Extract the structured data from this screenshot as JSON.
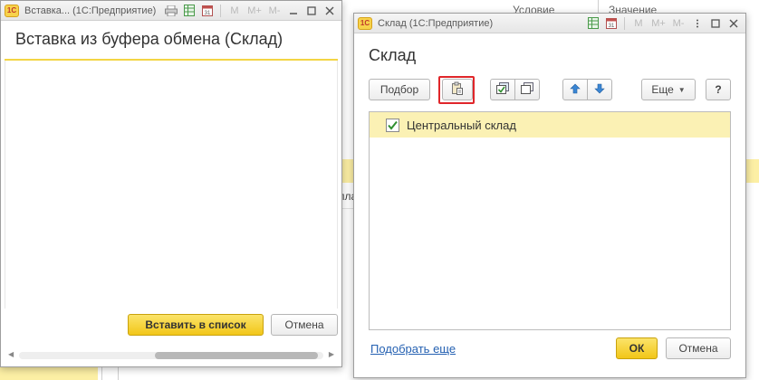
{
  "background": {
    "column_condition": "Условие",
    "column_value": "Значение",
    "fragment": "пла"
  },
  "left_window": {
    "app_logo": "1С",
    "window_title": "Вставка... (1С:Предприятие)",
    "toolbar_letters": [
      "M",
      "M+",
      "M-"
    ],
    "form_title": "Вставка из буфера обмена (Склад)",
    "insert_button": "Вставить в список",
    "cancel_button": "Отмена"
  },
  "right_window": {
    "app_logo": "1С",
    "window_title": "Склад (1С:Предприятие)",
    "toolbar_letters": [
      "M",
      "M+",
      "M-"
    ],
    "form_title": "Склад",
    "toolbar": {
      "pick_button": "Подбор",
      "more_button": "Еще",
      "help_button": "?"
    },
    "list_items": [
      {
        "label": "Центральный склад",
        "checked": true
      }
    ],
    "pick_more_link": "Подобрать еще",
    "ok_button": "ОК",
    "cancel_button": "Отмена"
  },
  "colors": {
    "accent_yellow": "#f2c618",
    "row_highlight": "#fbf1b4",
    "highlight_border": "#e0262a",
    "link_blue": "#2561b2"
  }
}
